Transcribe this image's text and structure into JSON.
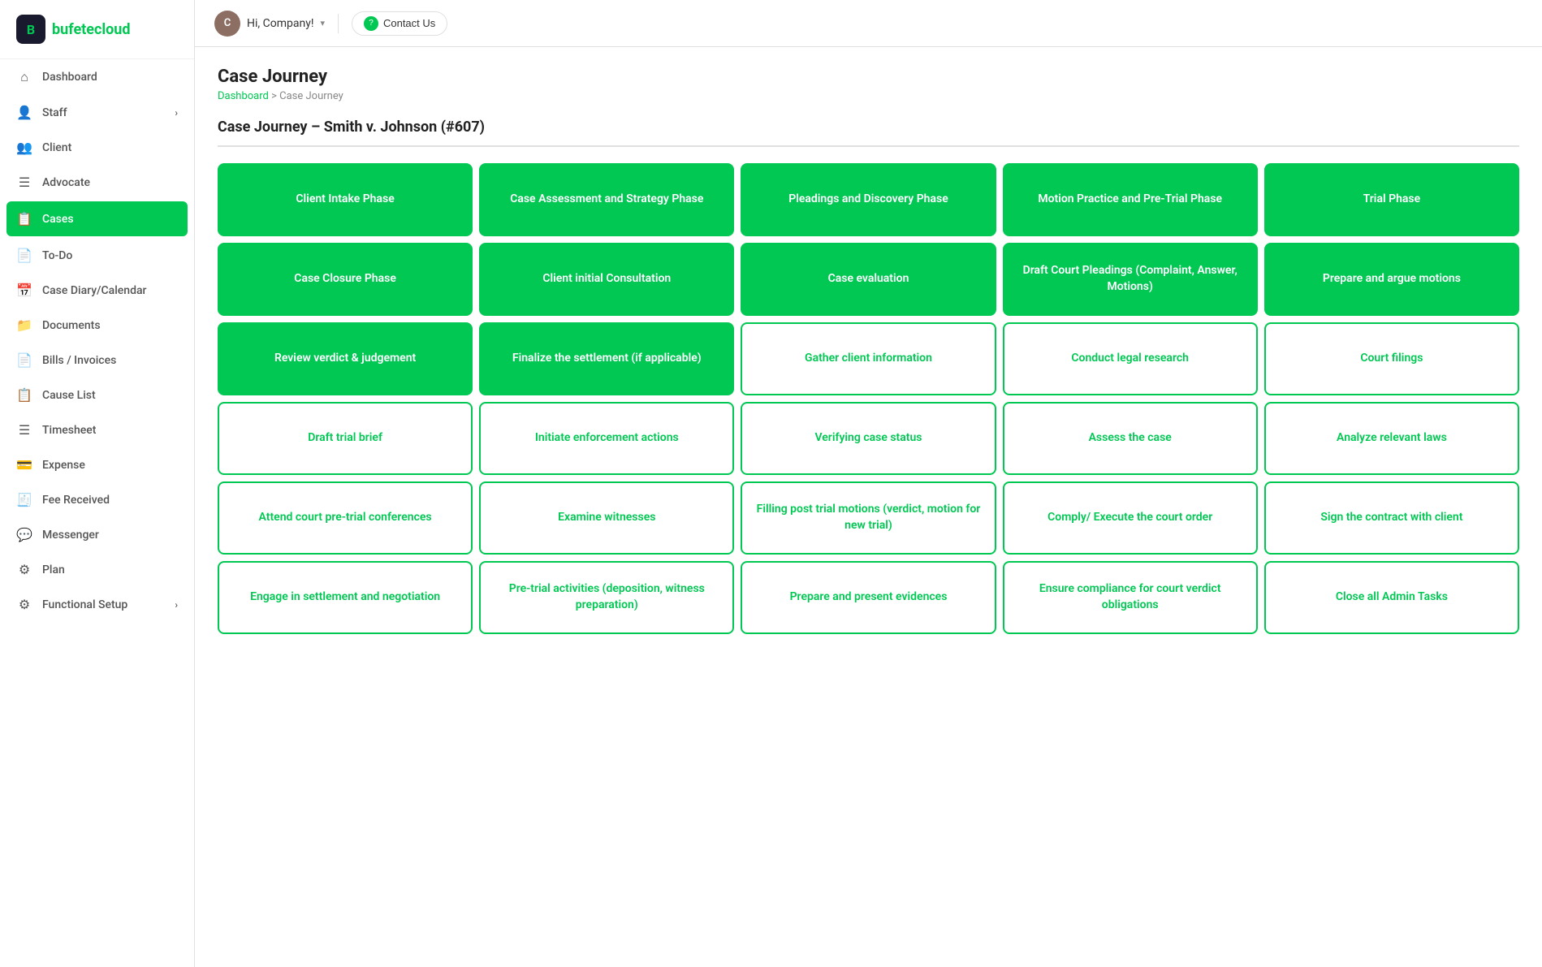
{
  "sidebar": {
    "logo": "bufetecloud",
    "logo_b": "bufete",
    "logo_c": "cloud",
    "items": [
      {
        "id": "dashboard",
        "label": "Dashboard",
        "icon": "⌂",
        "hasChevron": false,
        "active": false
      },
      {
        "id": "staff",
        "label": "Staff",
        "icon": "👤",
        "hasChevron": true,
        "active": false
      },
      {
        "id": "client",
        "label": "Client",
        "icon": "👥",
        "hasChevron": false,
        "active": false
      },
      {
        "id": "advocate",
        "label": "Advocate",
        "icon": "☰",
        "hasChevron": false,
        "active": false
      },
      {
        "id": "cases",
        "label": "Cases",
        "icon": "📋",
        "hasChevron": false,
        "active": true
      },
      {
        "id": "todo",
        "label": "To-Do",
        "icon": "📄",
        "hasChevron": false,
        "active": false
      },
      {
        "id": "diary",
        "label": "Case Diary/Calendar",
        "icon": "📅",
        "hasChevron": false,
        "active": false
      },
      {
        "id": "documents",
        "label": "Documents",
        "icon": "📁",
        "hasChevron": false,
        "active": false
      },
      {
        "id": "bills",
        "label": "Bills / Invoices",
        "icon": "📄",
        "hasChevron": false,
        "active": false
      },
      {
        "id": "causelist",
        "label": "Cause List",
        "icon": "📋",
        "hasChevron": false,
        "active": false
      },
      {
        "id": "timesheet",
        "label": "Timesheet",
        "icon": "☰",
        "hasChevron": false,
        "active": false
      },
      {
        "id": "expense",
        "label": "Expense",
        "icon": "💳",
        "hasChevron": false,
        "active": false
      },
      {
        "id": "fee",
        "label": "Fee Received",
        "icon": "🧾",
        "hasChevron": false,
        "active": false
      },
      {
        "id": "messenger",
        "label": "Messenger",
        "icon": "💬",
        "hasChevron": false,
        "active": false
      },
      {
        "id": "plan",
        "label": "Plan",
        "icon": "⚙",
        "hasChevron": false,
        "active": false
      },
      {
        "id": "functional",
        "label": "Functional Setup",
        "icon": "⚙",
        "hasChevron": true,
        "active": false
      }
    ]
  },
  "topbar": {
    "user_greeting": "Hi, Company!",
    "user_chevron": "∨",
    "contact_label": "Contact Us"
  },
  "page": {
    "title": "Case Journey",
    "breadcrumb_home": "Dashboard",
    "breadcrumb_separator": ">",
    "breadcrumb_current": "Case Journey",
    "case_title": "Case Journey – Smith v. Johnson (#607)"
  },
  "grid": {
    "rows": [
      [
        {
          "text": "Client Intake Phase",
          "style": "filled"
        },
        {
          "text": "Case Assessment and Strategy Phase",
          "style": "filled"
        },
        {
          "text": "Pleadings and Discovery Phase",
          "style": "filled"
        },
        {
          "text": "Motion Practice and Pre-Trial Phase",
          "style": "filled"
        },
        {
          "text": "Trial Phase",
          "style": "filled"
        }
      ],
      [
        {
          "text": "Case Closure Phase",
          "style": "filled"
        },
        {
          "text": "Client initial Consultation",
          "style": "filled"
        },
        {
          "text": "Case evaluation",
          "style": "filled"
        },
        {
          "text": "Draft Court Pleadings (Complaint, Answer, Motions)",
          "style": "filled"
        },
        {
          "text": "Prepare and argue motions",
          "style": "filled"
        }
      ],
      [
        {
          "text": "Review verdict & judgement",
          "style": "filled"
        },
        {
          "text": "Finalize the settlement (if applicable)",
          "style": "filled"
        },
        {
          "text": "Gather client information",
          "style": "outline"
        },
        {
          "text": "Conduct legal research",
          "style": "outline"
        },
        {
          "text": "Court filings",
          "style": "outline"
        }
      ],
      [
        {
          "text": "Draft trial brief",
          "style": "outline"
        },
        {
          "text": "Initiate enforcement actions",
          "style": "outline"
        },
        {
          "text": "Verifying case status",
          "style": "outline"
        },
        {
          "text": "Assess the case",
          "style": "outline"
        },
        {
          "text": "Analyze relevant laws",
          "style": "outline"
        }
      ],
      [
        {
          "text": "Attend court pre-trial conferences",
          "style": "outline"
        },
        {
          "text": "Examine witnesses",
          "style": "outline"
        },
        {
          "text": "Filling post trial motions (verdict, motion for new trial)",
          "style": "outline"
        },
        {
          "text": "Comply/ Execute the court order",
          "style": "outline"
        },
        {
          "text": "Sign the contract with client",
          "style": "outline"
        }
      ],
      [
        {
          "text": "Engage in settlement and negotiation",
          "style": "outline"
        },
        {
          "text": "Pre-trial activities (deposition, witness preparation)",
          "style": "outline"
        },
        {
          "text": "Prepare and present evidences",
          "style": "outline"
        },
        {
          "text": "Ensure compliance for court verdict obligations",
          "style": "outline"
        },
        {
          "text": "Close all Admin Tasks",
          "style": "outline"
        }
      ]
    ]
  }
}
